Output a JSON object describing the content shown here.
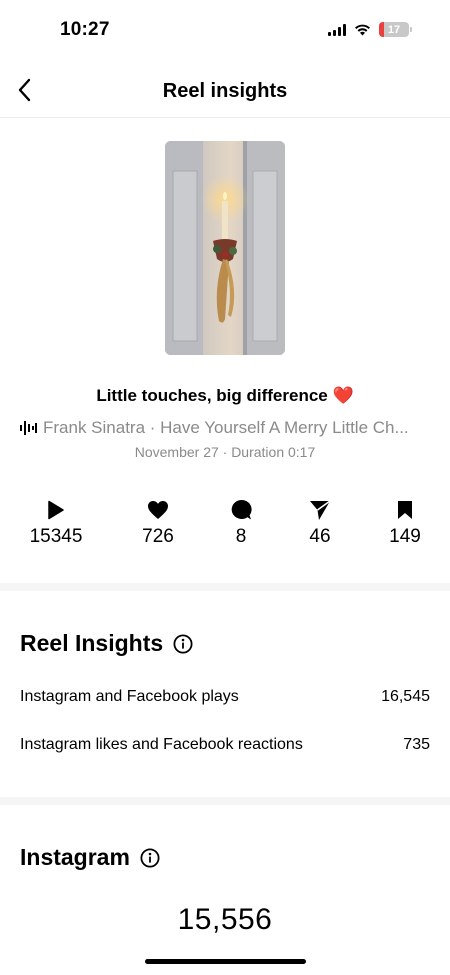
{
  "status_bar": {
    "time": "10:27",
    "battery_level": "17",
    "battery_color": "#e8413e"
  },
  "header": {
    "title": "Reel insights",
    "back_icon": "chevron-left-icon"
  },
  "reel": {
    "caption": "Little touches, big difference",
    "caption_emoji": "❤️",
    "audio": "Frank Sinatra · Have Yourself A Merry Little Ch...",
    "meta": "November 27 · Duration 0:17"
  },
  "stats": [
    {
      "icon": "play-icon",
      "value": "15345"
    },
    {
      "icon": "heart-icon",
      "value": "726"
    },
    {
      "icon": "comment-icon",
      "value": "8"
    },
    {
      "icon": "share-icon",
      "value": "46"
    },
    {
      "icon": "save-icon",
      "value": "149"
    }
  ],
  "reel_insights": {
    "title": "Reel Insights",
    "rows": [
      {
        "label": "Instagram and Facebook plays",
        "value": "16,545"
      },
      {
        "label": "Instagram likes and Facebook reactions",
        "value": "735"
      }
    ]
  },
  "instagram": {
    "title": "Instagram",
    "plays": "15,556"
  }
}
